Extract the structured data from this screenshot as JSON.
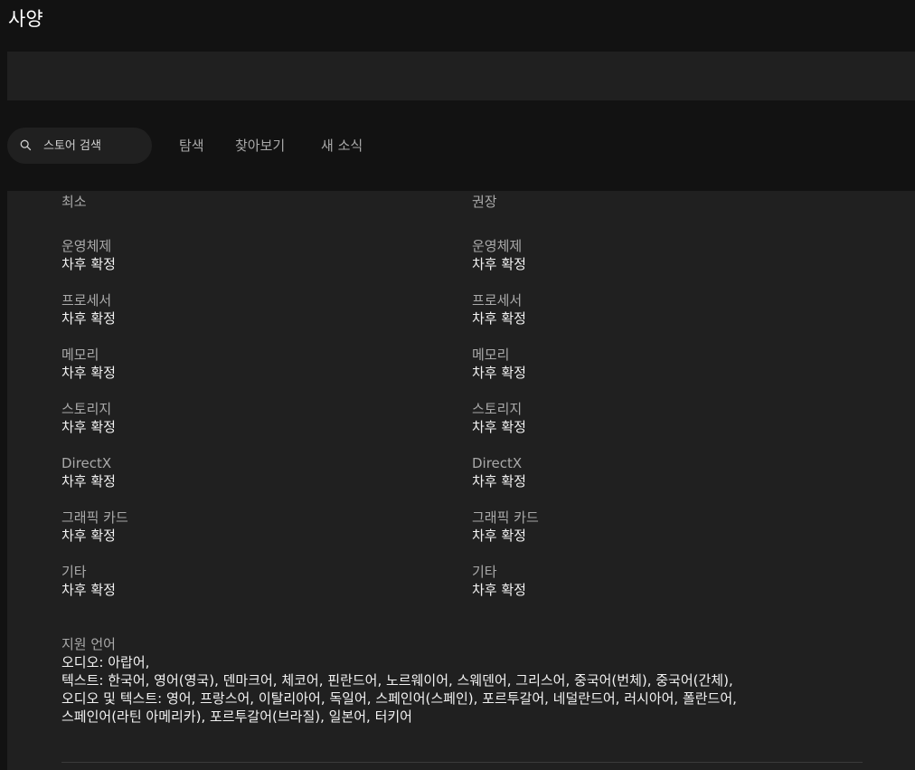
{
  "page": {
    "title": "사양"
  },
  "search": {
    "placeholder": "스토어 검색",
    "value": ""
  },
  "nav": {
    "discover": "탐색",
    "browse": "찾아보기",
    "news": "새 소식"
  },
  "specs": {
    "minimum": {
      "header": "최소",
      "items": [
        {
          "label": "운영체제",
          "value": "차후 확정"
        },
        {
          "label": "프로세서",
          "value": "차후 확정"
        },
        {
          "label": "메모리",
          "value": "차후 확정"
        },
        {
          "label": "스토리지",
          "value": "차후 확정"
        },
        {
          "label": "DirectX",
          "value": "차후 확정"
        },
        {
          "label": "그래픽 카드",
          "value": "차후 확정"
        },
        {
          "label": "기타",
          "value": "차후 확정"
        }
      ]
    },
    "recommended": {
      "header": "권장",
      "items": [
        {
          "label": "운영체제",
          "value": "차후 확정"
        },
        {
          "label": "프로세서",
          "value": "차후 확정"
        },
        {
          "label": "메모리",
          "value": "차후 확정"
        },
        {
          "label": "스토리지",
          "value": "차후 확정"
        },
        {
          "label": "DirectX",
          "value": "차후 확정"
        },
        {
          "label": "그래픽 카드",
          "value": "차후 확정"
        },
        {
          "label": "기타",
          "value": "차후 확정"
        }
      ]
    }
  },
  "languages": {
    "label": "지원 언어",
    "lines": [
      "오디오: 아랍어,",
      "텍스트: 한국어, 영어(영국), 덴마크어, 체코어, 핀란드어, 노르웨이어, 스웨덴어, 그리스어, 중국어(번체), 중국어(간체),",
      "오디오 및 텍스트: 영어, 프랑스어, 이탈리아어, 독일어, 스페인어(스페인), 포르투갈어, 네덜란드어, 러시아어, 폴란드어,",
      "스페인어(라틴 아메리카), 포르투갈어(브라질), 일본어, 터키어"
    ]
  }
}
